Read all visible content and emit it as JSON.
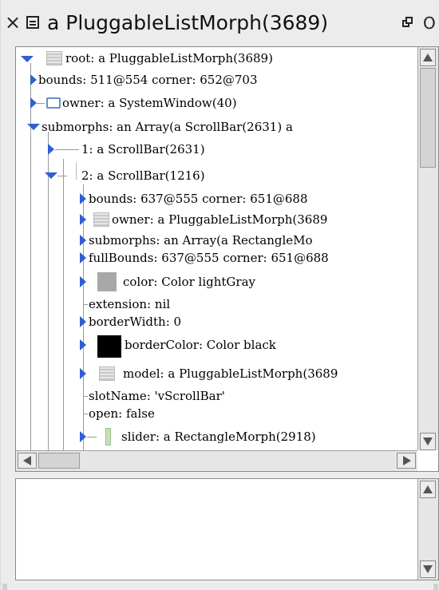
{
  "window": {
    "title": "a PluggableListMorph(3689)",
    "close_glyph": "×",
    "expand_glyph": "O"
  },
  "tree": {
    "rows": [
      {
        "text": "root: a PluggableListMorph(3689)",
        "expanded": true,
        "icon": "morph-thumbnail-icon"
      },
      {
        "text": "bounds: 511@554 corner: 652@703",
        "expanded": false,
        "icon": null
      },
      {
        "text": "owner: a SystemWindow(40)",
        "expanded": false,
        "icon": "window-icon"
      },
      {
        "text": "submorphs: an Array(a ScrollBar(2631) a",
        "expanded": true,
        "icon": null
      },
      {
        "text": "1: a ScrollBar(2631)",
        "expanded": false,
        "icon": null
      },
      {
        "text": "2: a ScrollBar(1216)",
        "expanded": true,
        "icon": null
      },
      {
        "text": "bounds: 637@555 corner: 651@688",
        "expanded": false,
        "icon": null
      },
      {
        "text": "owner: a PluggableListMorph(3689",
        "expanded": false,
        "icon": "morph-thumbnail-icon"
      },
      {
        "text": "submorphs: an Array(a RectangleMo",
        "expanded": false,
        "icon": null
      },
      {
        "text": "fullBounds: 637@555 corner: 651@688",
        "expanded": false,
        "icon": null
      },
      {
        "text": "color: Color lightGray",
        "expanded": false,
        "icon": "light-gray-swatch",
        "color": "#a8a8a8"
      },
      {
        "text": "extension: nil",
        "expanded": null,
        "icon": null
      },
      {
        "text": "borderWidth: 0",
        "expanded": false,
        "icon": null
      },
      {
        "text": "borderColor: Color black",
        "expanded": false,
        "icon": "black-swatch",
        "color": "#000000"
      },
      {
        "text": "model: a PluggableListMorph(3689",
        "expanded": false,
        "icon": "morph-thumbnail-icon"
      },
      {
        "text": "slotName: 'vScrollBar'",
        "expanded": null,
        "icon": null
      },
      {
        "text": "open: false",
        "expanded": null,
        "icon": null
      },
      {
        "text": "slider: a RectangleMorph(2918)",
        "expanded": false,
        "icon": "slider-bar-icon"
      }
    ]
  },
  "colors": {
    "arrow": "#2f5fd0",
    "window_bg": "#ececec",
    "pane_border": "#8a8a8a"
  }
}
